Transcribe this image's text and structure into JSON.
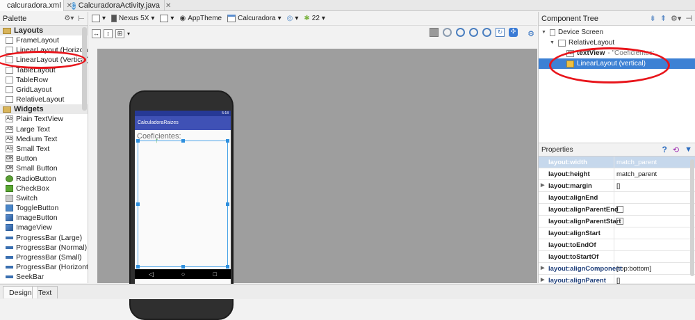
{
  "editor_tabs": [
    {
      "label": "calcuradora.xml",
      "icon": "xml-file-icon",
      "active": true
    },
    {
      "label": "CalcuradoraActivity.java",
      "icon": "java-class-icon",
      "active": false
    }
  ],
  "palette": {
    "title": "Palette",
    "groups": [
      {
        "label": "Layouts",
        "items": [
          {
            "label": "FrameLayout",
            "icon": "frame-layout-icon"
          },
          {
            "label": "LinearLayout (Horizontal)",
            "icon": "linear-layout-h-icon"
          },
          {
            "label": "LinearLayout (Vertical)",
            "icon": "linear-layout-v-icon"
          },
          {
            "label": "TableLayout",
            "icon": "table-layout-icon"
          },
          {
            "label": "TableRow",
            "icon": "table-row-icon"
          },
          {
            "label": "GridLayout",
            "icon": "grid-layout-icon"
          },
          {
            "label": "RelativeLayout",
            "icon": "relative-layout-icon"
          }
        ]
      },
      {
        "label": "Widgets",
        "items": [
          {
            "label": "Plain TextView",
            "icon": "textview-icon"
          },
          {
            "label": "Large Text",
            "icon": "textview-icon"
          },
          {
            "label": "Medium Text",
            "icon": "textview-icon"
          },
          {
            "label": "Small Text",
            "icon": "textview-icon"
          },
          {
            "label": "Button",
            "icon": "button-icon"
          },
          {
            "label": "Small Button",
            "icon": "button-icon"
          },
          {
            "label": "RadioButton",
            "icon": "radio-icon"
          },
          {
            "label": "CheckBox",
            "icon": "checkbox-icon"
          },
          {
            "label": "Switch",
            "icon": "switch-icon"
          },
          {
            "label": "ToggleButton",
            "icon": "toggle-icon"
          },
          {
            "label": "ImageButton",
            "icon": "image-button-icon"
          },
          {
            "label": "ImageView",
            "icon": "image-view-icon"
          },
          {
            "label": "ProgressBar (Large)",
            "icon": "progress-icon"
          },
          {
            "label": "ProgressBar (Normal)",
            "icon": "progress-icon"
          },
          {
            "label": "ProgressBar (Small)",
            "icon": "progress-icon"
          },
          {
            "label": "ProgressBar (Horizontal)",
            "icon": "progress-icon"
          },
          {
            "label": "SeekBar",
            "icon": "seekbar-icon"
          }
        ]
      }
    ]
  },
  "designer_toolbar": {
    "device": "Nexus 5X",
    "theme": "AppTheme",
    "activity": "Calcuradora",
    "api": "22"
  },
  "phone": {
    "status_time": "5:18",
    "app_title": "CalculadoraRaizes",
    "text_view": "Coeficientes:",
    "nav_back": "◁",
    "nav_home": "○",
    "nav_recent": "□"
  },
  "component_tree": {
    "title": "Component Tree",
    "nodes": [
      {
        "label": "Device Screen",
        "depth": 0
      },
      {
        "label": "RelativeLayout",
        "depth": 1
      },
      {
        "label": "textView",
        "suffix": " - \"Coeficientes:",
        "depth": 2
      },
      {
        "label": "LinearLayout (vertical)",
        "depth": 2,
        "selected": true
      }
    ]
  },
  "properties": {
    "title": "Properties",
    "rows": [
      {
        "name": "layout:width",
        "value": "match_parent",
        "selected": true
      },
      {
        "name": "layout:height",
        "value": "match_parent"
      },
      {
        "name": "layout:margin",
        "value": "[]",
        "expandable": true
      },
      {
        "name": "layout:alignEnd",
        "value": ""
      },
      {
        "name": "layout:alignParentEnd",
        "value": "",
        "checkbox": true
      },
      {
        "name": "layout:alignParentStart",
        "value": "",
        "checkbox": true
      },
      {
        "name": "layout:alignStart",
        "value": ""
      },
      {
        "name": "layout:toEndOf",
        "value": ""
      },
      {
        "name": "layout:toStartOf",
        "value": ""
      },
      {
        "name": "layout:alignComponent",
        "value": "[top:bottom]",
        "expandable": true,
        "highlight": true
      },
      {
        "name": "layout:alignParent",
        "value": "[]",
        "expandable": true,
        "highlight": true
      }
    ]
  },
  "bottom_tabs": [
    {
      "label": "Design",
      "active": true
    },
    {
      "label": "Text",
      "active": false
    }
  ],
  "colors": {
    "annotation": "#e8151b",
    "selection": "#3d81d4",
    "app_bar": "#3f51b5"
  }
}
